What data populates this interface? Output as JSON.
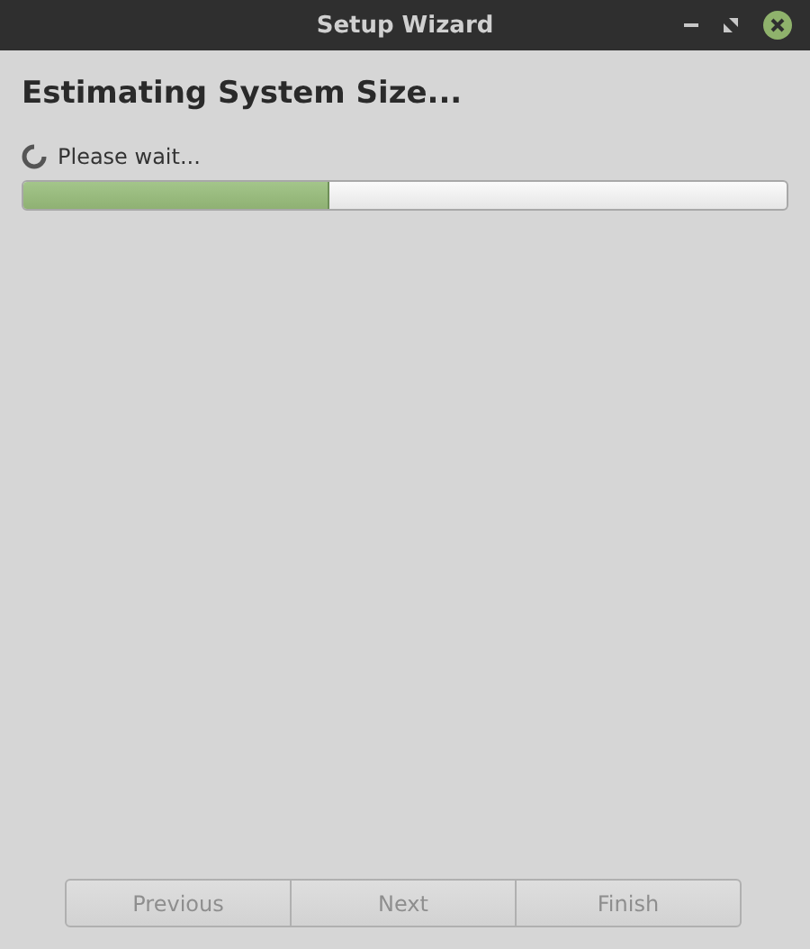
{
  "window": {
    "title": "Setup Wizard"
  },
  "heading": "Estimating System Size...",
  "status": {
    "text": "Please wait...",
    "level": 0.4
  },
  "buttons": [
    {
      "label": "Previous",
      "disabled": true
    },
    {
      "label": "Next",
      "disabled": true
    },
    {
      "label": "Finish",
      "disabled": true
    }
  ]
}
